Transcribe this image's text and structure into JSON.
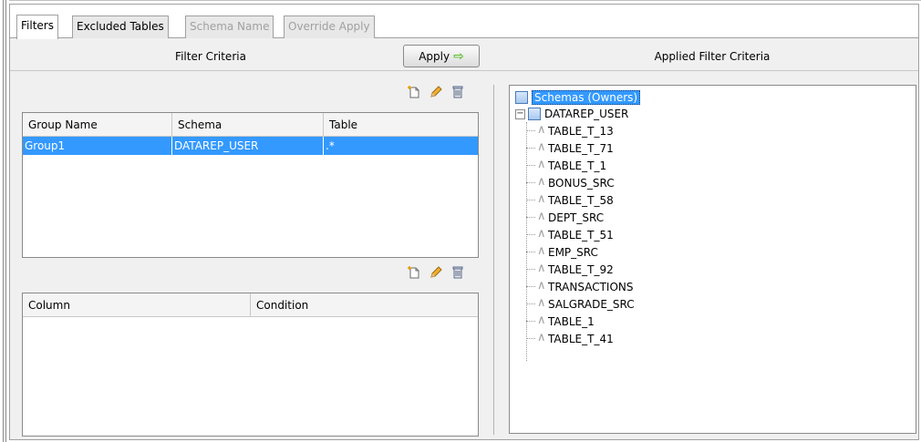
{
  "tabs": [
    {
      "label": "Filters",
      "state": "active"
    },
    {
      "label": "Excluded Tables",
      "state": "normal"
    },
    {
      "label": "Schema Name",
      "state": "disabled"
    },
    {
      "label": "Override Apply",
      "state": "disabled"
    }
  ],
  "headers": {
    "filter_criteria": "Filter Criteria",
    "applied_filter_criteria": "Applied Filter Criteria"
  },
  "apply_button": {
    "label": "Apply",
    "icon": "green-right-arrow-icon"
  },
  "groups_table": {
    "toolbar_icons": [
      "new-icon",
      "edit-pencil-icon",
      "delete-trash-icon"
    ],
    "columns": [
      "Group Name",
      "Schema",
      "Table"
    ],
    "rows": [
      {
        "group_name": "Group1",
        "schema": "DATAREP_USER",
        "table": ".*",
        "selected": true
      }
    ]
  },
  "conditions_table": {
    "toolbar_icons": [
      "new-icon",
      "edit-pencil-icon",
      "delete-trash-icon"
    ],
    "columns": [
      "Column",
      "Condition"
    ],
    "rows": []
  },
  "tree": {
    "root": "Schemas (Owners)",
    "schema": "DATAREP_USER",
    "tables": [
      "TABLE_T_13",
      "TABLE_T_71",
      "TABLE_T_1",
      "BONUS_SRC",
      "TABLE_T_58",
      "DEPT_SRC",
      "TABLE_T_51",
      "EMP_SRC",
      "TABLE_T_92",
      "TRANSACTIONS",
      "SALGRADE_SRC",
      "TABLE_1",
      "TABLE_T_41"
    ]
  },
  "colors": {
    "selection": "#3399ff",
    "apply_arrow": "#5cbf2a",
    "panel_bg": "#f0f0f0"
  }
}
